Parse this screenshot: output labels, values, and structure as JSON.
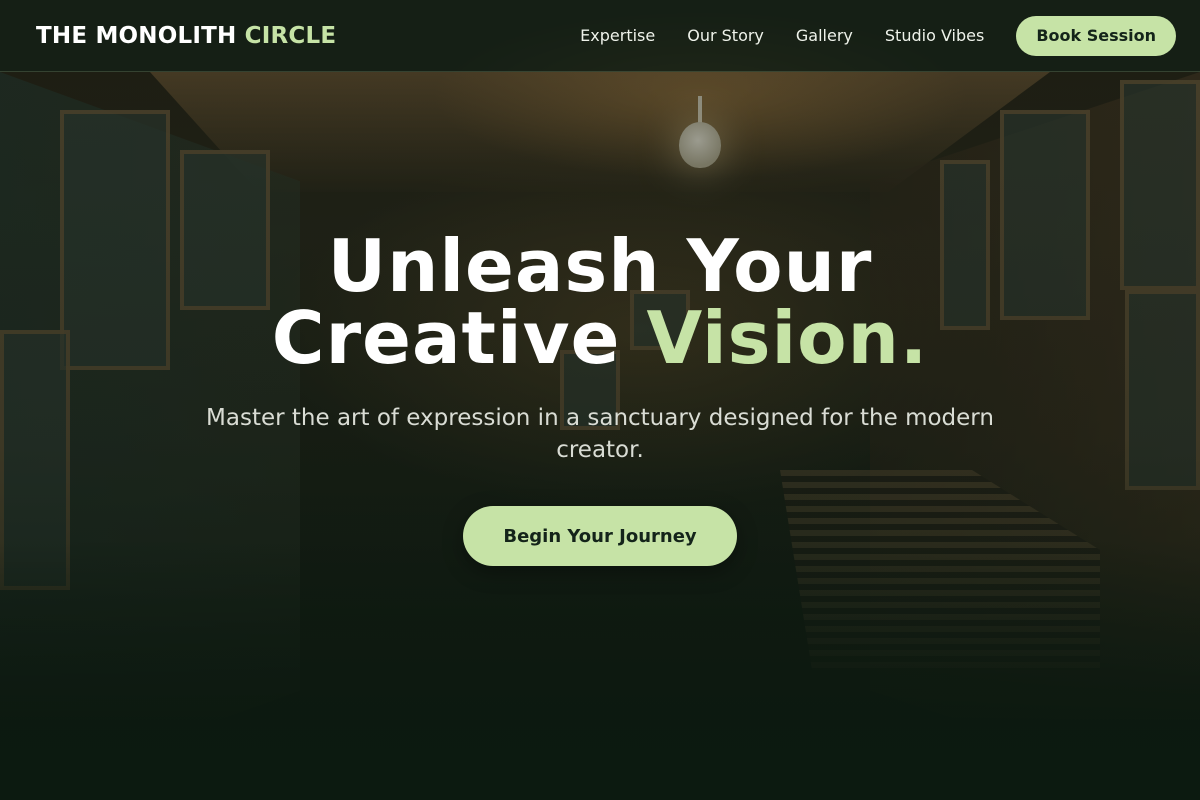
{
  "brand": {
    "name": "THE MONOLITH",
    "accent": "CIRCLE"
  },
  "nav": {
    "links": [
      {
        "label": "Expertise"
      },
      {
        "label": "Our Story"
      },
      {
        "label": "Gallery"
      },
      {
        "label": "Studio Vibes"
      }
    ],
    "cta_label": "Book Session"
  },
  "hero": {
    "title_line1": "Unleash Your",
    "title_line2_plain": "Creative",
    "title_line2_accent": "Vision.",
    "subtitle": "Master the art of expression in a sanctuary designed for the modern creator.",
    "cta_label": "Begin Your Journey"
  },
  "colors": {
    "accent": "#c6e3a6",
    "header_bg": "#142016",
    "text": "#ffffff",
    "button_text": "#14241a"
  }
}
